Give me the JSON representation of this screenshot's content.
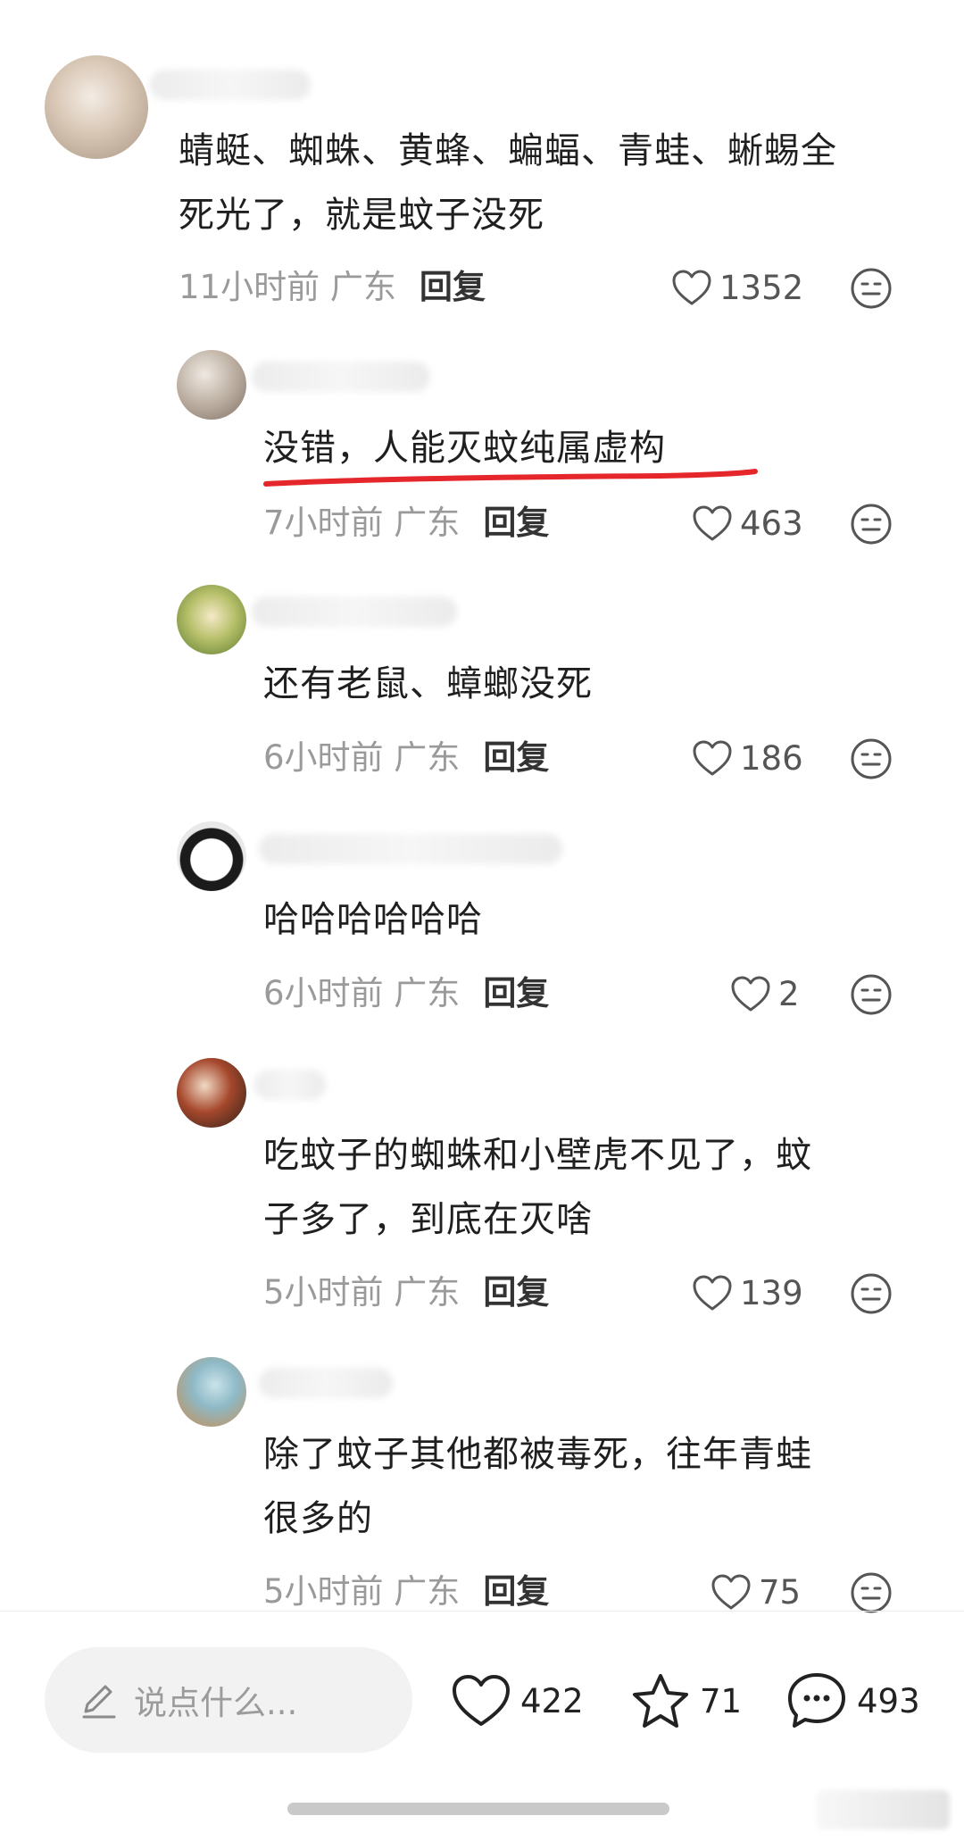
{
  "comments": [
    {
      "avatar_icon": "dog-avatar",
      "text_line1": "蜻蜓、蜘蛛、黄蜂、蝙蝠、青蛙、蜥蜴全",
      "text_line2": "死光了，就是蚊子没死",
      "time": "11小时前 广东",
      "reply": "回复",
      "likes": "1352"
    },
    {
      "avatar_icon": "person-avatar",
      "text_line1": "没错，人能灭蚊纯属虚构",
      "time": "7小时前 广东",
      "reply": "回复",
      "likes": "463",
      "highlight_color": "#e5262b"
    },
    {
      "avatar_icon": "cartoon-avatar",
      "text_line1": "还有老鼠、蟑螂没死",
      "time": "6小时前 广东",
      "reply": "回复",
      "likes": "186"
    },
    {
      "avatar_icon": "penguin-avatar",
      "text_line1": "哈哈哈哈哈哈",
      "time": "6小时前 广东",
      "reply": "回复",
      "likes": "2"
    },
    {
      "avatar_icon": "photo-avatar",
      "text_line1": "吃蚊子的蜘蛛和小壁虎不见了，蚊",
      "text_line2": "子多了，到底在灭啥",
      "time": "5小时前 广东",
      "reply": "回复",
      "likes": "139"
    },
    {
      "avatar_icon": "toy-avatar",
      "text_line1": "除了蚊子其他都被毒死，往年青蛙",
      "text_line2": "很多的",
      "time": "5小时前 广东",
      "reply": "回复",
      "likes": "75"
    }
  ],
  "bottom_bar": {
    "input_placeholder": "说点什么...",
    "like_count": "422",
    "star_count": "71",
    "comment_count": "493"
  }
}
